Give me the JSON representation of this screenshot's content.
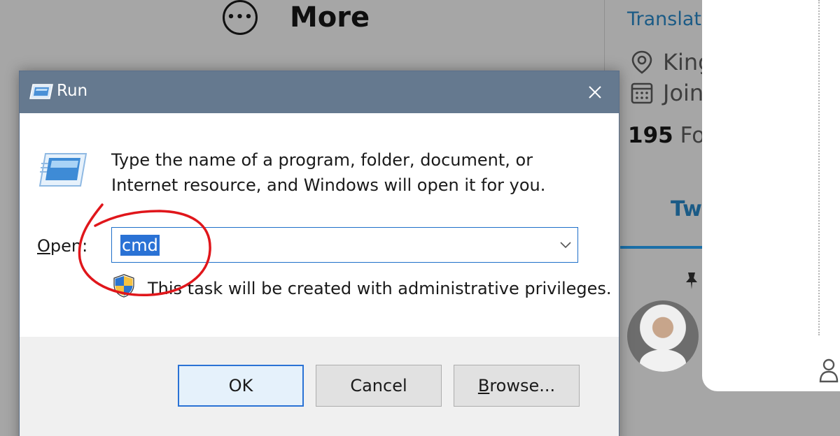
{
  "background": {
    "more_label": "More",
    "translate_link": "Translate",
    "location_text": "King",
    "joined_text": "Join",
    "followers_count": "195",
    "followers_label": "Fol",
    "tab_label": "Tw"
  },
  "run_dialog": {
    "title": "Run",
    "description_line1": "Type the name of a program, folder, document, or",
    "description_line2": "Internet resource, and Windows will open it for you.",
    "open_label_underlined": "O",
    "open_label_rest": "pen:",
    "open_value": "cmd",
    "admin_note": "This task will be created with administrative privileges.",
    "buttons": {
      "ok": "OK",
      "cancel": "Cancel",
      "browse_underlined": "B",
      "browse_rest": "rowse..."
    }
  },
  "colors": {
    "titlebar": "#65798f",
    "selection": "#2a72d5",
    "annotation": "#e0161b"
  },
  "icons": [
    "more-icon",
    "location-icon",
    "calendar-icon",
    "pin-icon",
    "run-icon",
    "close-icon",
    "chevron-down-icon",
    "uac-shield-icon",
    "person-icon"
  ]
}
